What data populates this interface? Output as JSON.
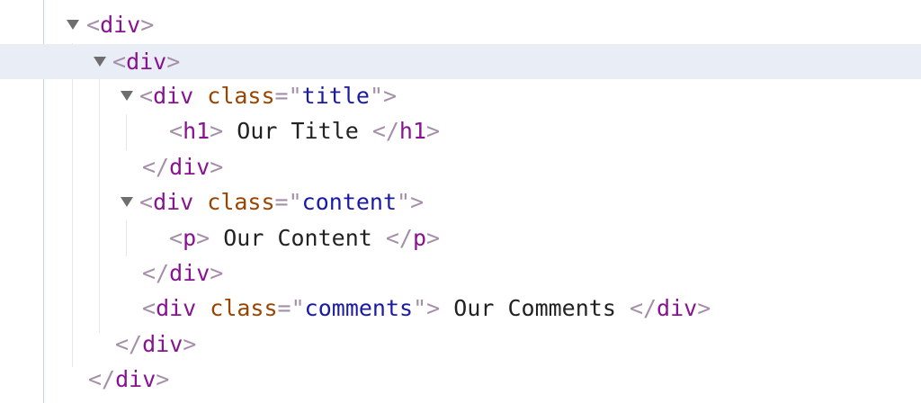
{
  "elements_panel": {
    "nodes": [
      {
        "id": "n1",
        "prefix": "<",
        "tag": "div",
        "suffix": ">",
        "expanded": true
      },
      {
        "id": "n2",
        "prefix": "<",
        "tag": "div",
        "suffix": ">",
        "expanded": true,
        "selected": true
      },
      {
        "id": "n3",
        "prefix": "<",
        "tag": "div",
        "attr_name": "class",
        "eq": "=",
        "quote": "\"",
        "attr_value": "title",
        "suffix": ">",
        "expanded": true
      },
      {
        "id": "n4",
        "open": "<",
        "tag": "h1",
        "open_end": ">",
        "text": " Our Title ",
        "close": "</",
        "close_tag": "h1",
        "close_end": ">"
      },
      {
        "id": "n5",
        "prefix": "</",
        "tag": "div",
        "suffix": ">"
      },
      {
        "id": "n6",
        "prefix": "<",
        "tag": "div",
        "attr_name": "class",
        "eq": "=",
        "quote": "\"",
        "attr_value": "content",
        "suffix": ">",
        "expanded": true
      },
      {
        "id": "n7",
        "open": "<",
        "tag": "p",
        "open_end": ">",
        "text": " Our Content ",
        "close": "</",
        "close_tag": "p",
        "close_end": ">"
      },
      {
        "id": "n8",
        "prefix": "</",
        "tag": "div",
        "suffix": ">"
      },
      {
        "id": "n9",
        "open": "<",
        "tag": "div",
        "attr_name": "class",
        "eq": "=",
        "quote": "\"",
        "attr_value": "comments",
        "open_end": ">",
        "text": " Our Comments ",
        "close": "</",
        "close_tag": "div",
        "close_end": ">"
      },
      {
        "id": "n10",
        "prefix": "</",
        "tag": "div",
        "suffix": ">"
      },
      {
        "id": "n11",
        "prefix": "</",
        "tag": "div",
        "suffix": ">"
      }
    ]
  }
}
